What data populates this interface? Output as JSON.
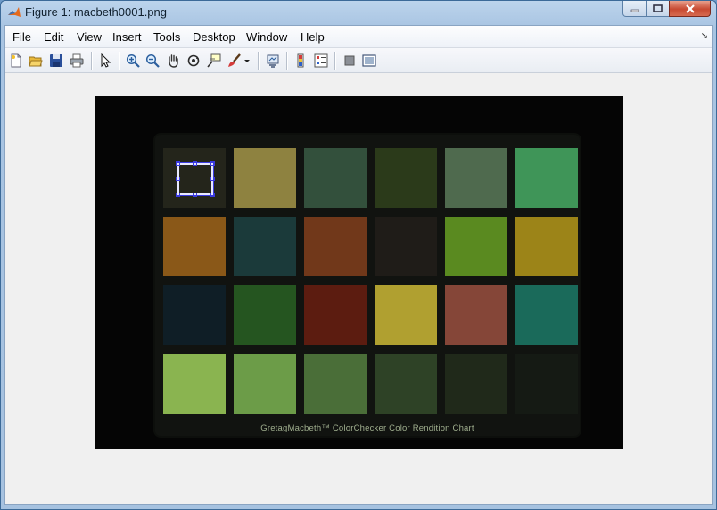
{
  "window": {
    "title": "Figure 1: macbeth0001.png",
    "controls": [
      "minimize",
      "maximize",
      "close"
    ]
  },
  "menubar": {
    "items": [
      "File",
      "Edit",
      "View",
      "Insert",
      "Tools",
      "Desktop",
      "Window",
      "Help"
    ],
    "dock_arrow": "↘"
  },
  "toolbar": {
    "icons": [
      "new-figure-icon",
      "open-file-icon",
      "save-icon",
      "print-icon",
      "edit-plot-icon",
      "zoom-in-icon",
      "zoom-out-icon",
      "pan-icon",
      "rotate-3d-icon",
      "data-cursor-icon",
      "brush-icon",
      "brush-dropdown-icon",
      "link-plot-icon",
      "insert-colorbar-icon",
      "insert-legend-icon",
      "hide-plot-tools-icon",
      "show-plot-tools-icon"
    ]
  },
  "image": {
    "caption": "GretagMacbeth™ ColorChecker Color Rendition Chart",
    "patch_colors": [
      [
        "#24251b",
        "#8e8240",
        "#33503c",
        "#2b3a1a",
        "#4f6a4e",
        "#3f9558"
      ],
      [
        "#8a5818",
        "#1b3a3a",
        "#71381a",
        "#1f1c18",
        "#5a8a20",
        "#9c8418"
      ],
      [
        "#0f1e26",
        "#255520",
        "#5c1c10",
        "#b0a030",
        "#854638",
        "#1a6a5a"
      ],
      [
        "#8ab450",
        "#6c9c48",
        "#4a6e38",
        "#2e4226",
        "#20291a",
        "#151a14"
      ]
    ],
    "selection_color": "#e8e8ff",
    "handle_color": "#3a3ae0"
  }
}
